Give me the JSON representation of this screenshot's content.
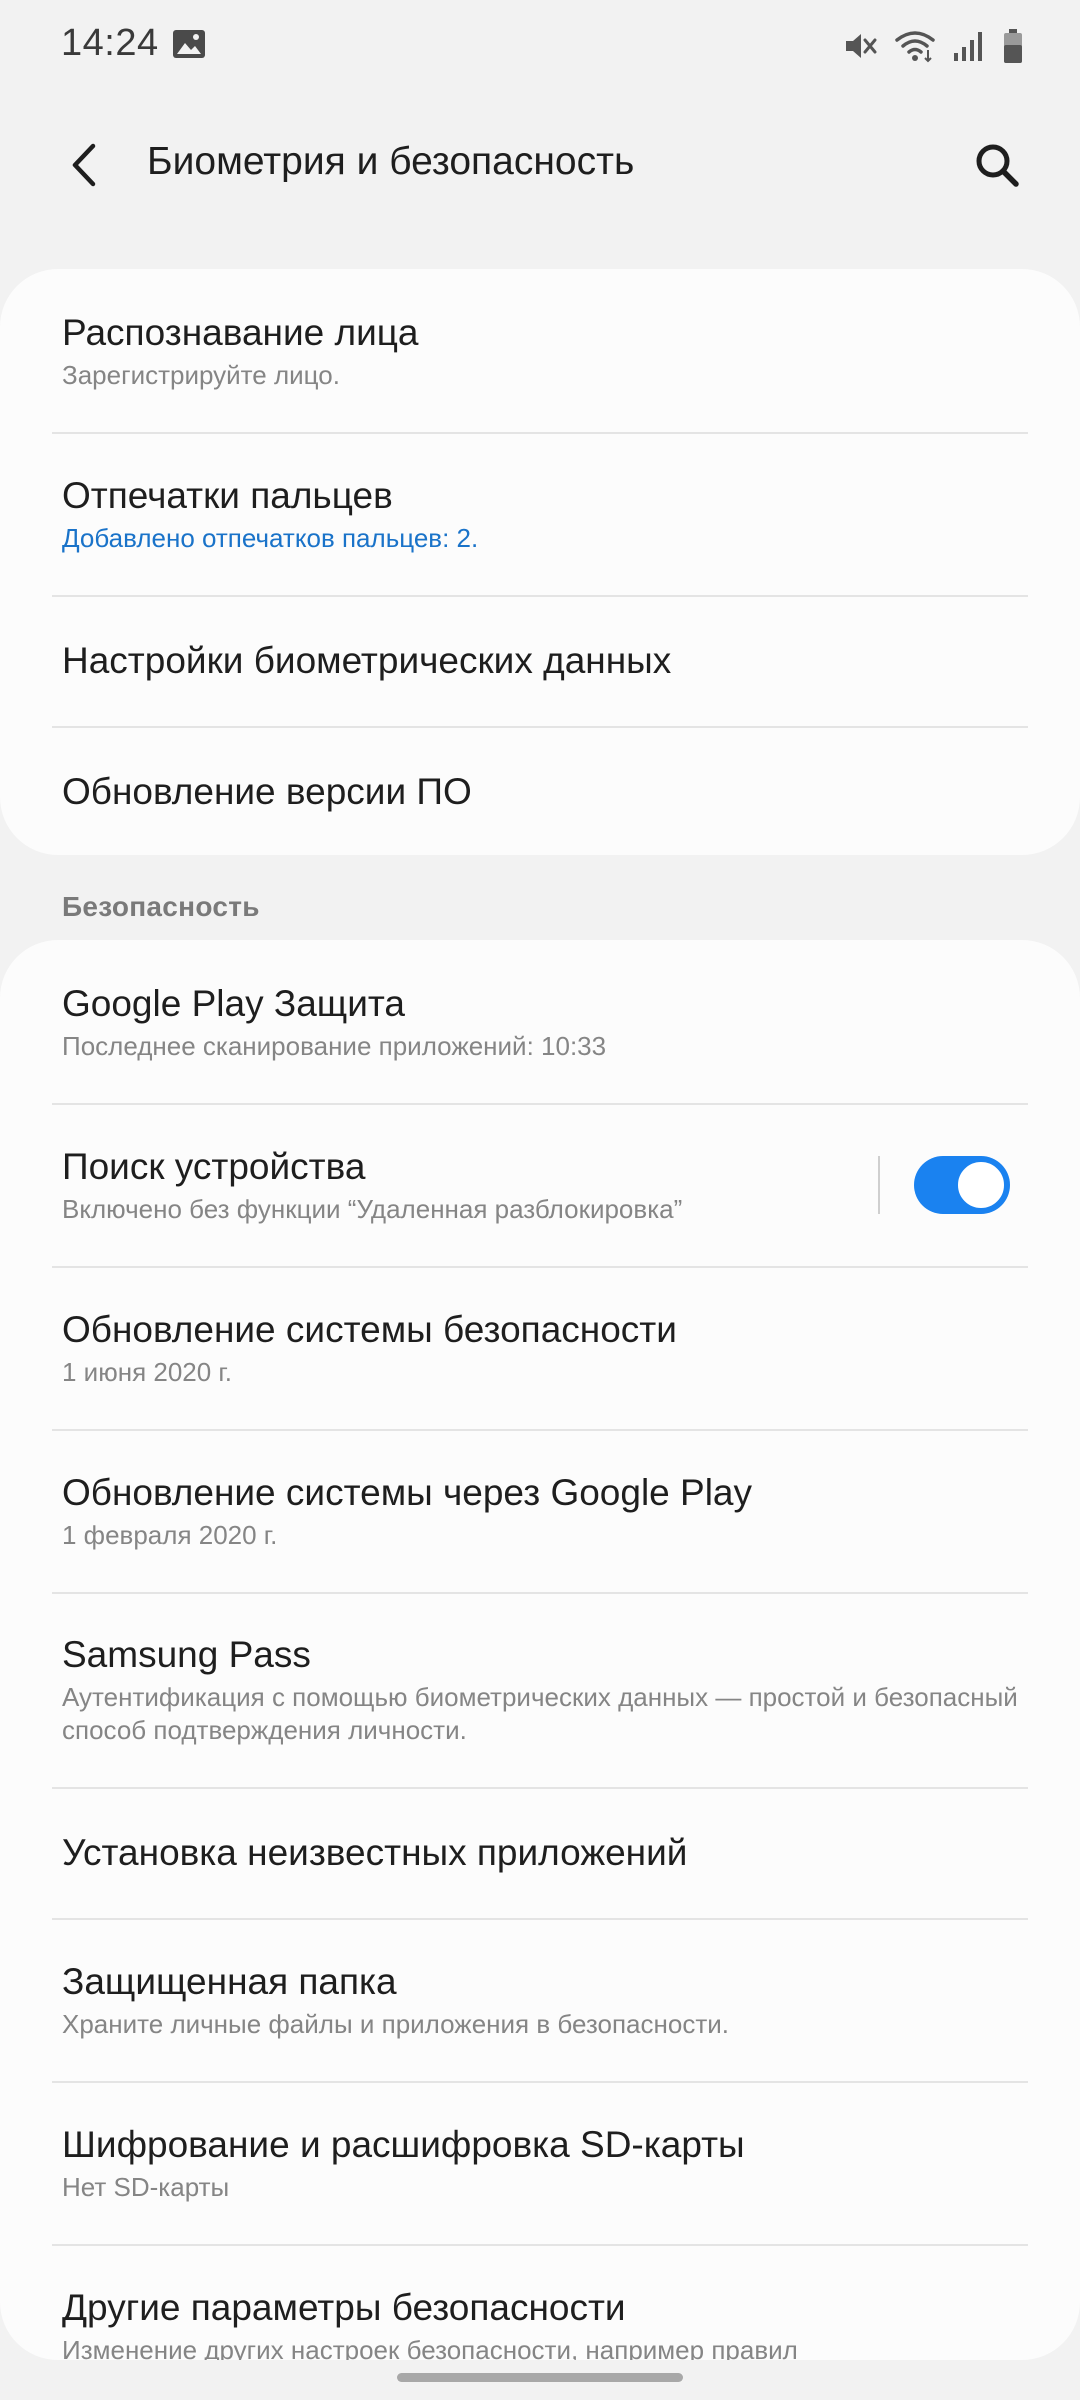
{
  "status_bar": {
    "time": "14:24",
    "icons": [
      "gallery-icon",
      "mute-icon",
      "wifi-icon",
      "signal-icon",
      "battery-icon"
    ]
  },
  "app_bar": {
    "title": "Биометрия и безопасность",
    "back_icon": "back-arrow-icon",
    "search_icon": "search-icon"
  },
  "biometrics": {
    "items": [
      {
        "title": "Распознавание лица",
        "subtitle": "Зарегистрируйте лицо."
      },
      {
        "title": "Отпечатки пальцев",
        "subtitle": "Добавлено отпечатков пальцев: 2."
      },
      {
        "title": "Настройки биометрических данных"
      },
      {
        "title": "Обновление версии ПО"
      }
    ]
  },
  "security": {
    "header": "Безопасность",
    "items": [
      {
        "title": "Google Play Защита",
        "subtitle": "Последнее сканирование приложений: 10:33"
      },
      {
        "title": "Поиск устройства",
        "subtitle": "Включено без функции “Удаленная разблокировка”",
        "toggle": true
      },
      {
        "title": "Обновление системы безопасности",
        "subtitle": "1 июня 2020 г."
      },
      {
        "title": "Обновление системы через Google Play",
        "subtitle": "1 февраля 2020 г."
      },
      {
        "title": "Samsung Pass",
        "subtitle": "Аутентификация с помощью биометрических данных — простой и безопасный способ подтверждения личности."
      },
      {
        "title": "Установка неизвестных приложений"
      },
      {
        "title": "Защищенная папка",
        "subtitle": "Храните личные файлы и приложения в безопасности."
      },
      {
        "title": "Шифрование и расшифровка SD-карты",
        "subtitle": "Нет SD-карты"
      },
      {
        "title": "Другие параметры безопасности",
        "subtitle": "Изменение других настроек безопасности, например правил"
      }
    ]
  },
  "colors": {
    "accent": "#1a73c9",
    "toggle_on": "#1a82f0",
    "background": "#f2f2f2",
    "card": "#fcfcfc"
  }
}
